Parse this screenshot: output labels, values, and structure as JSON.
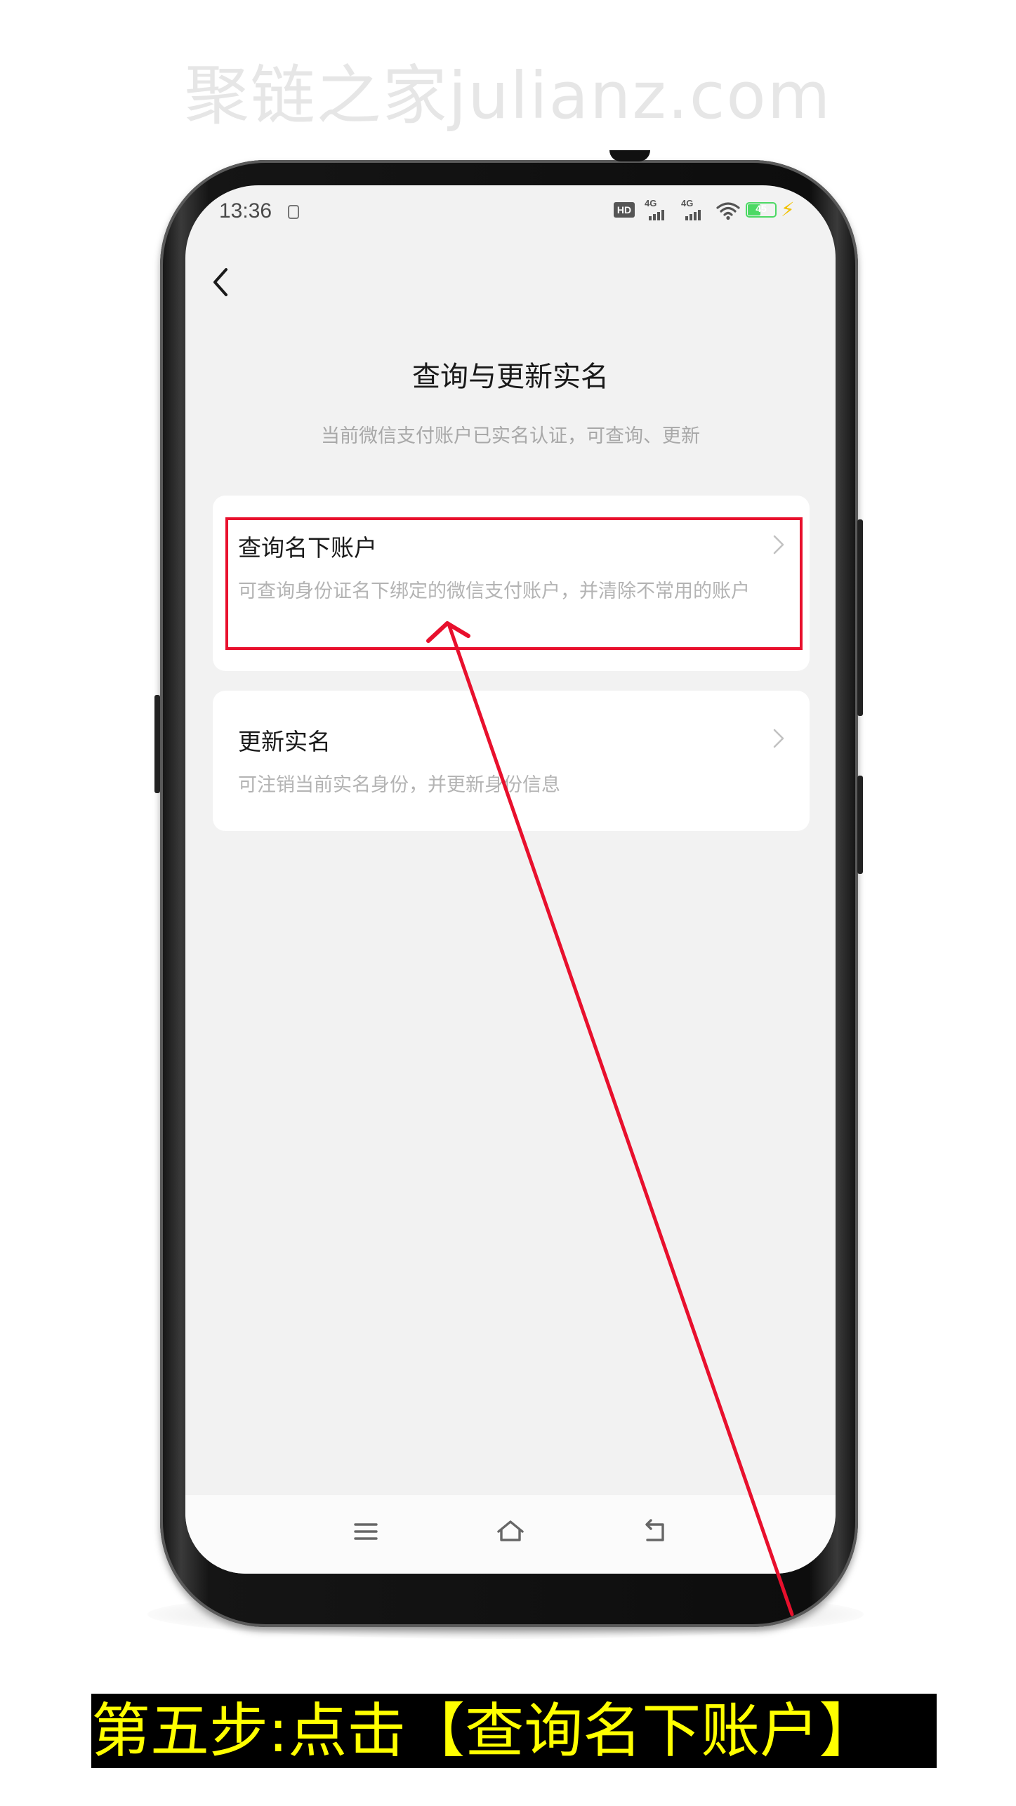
{
  "watermark": "聚链之家julianz.com",
  "status_bar": {
    "time": "13:36",
    "hd_label": "HD",
    "net1_label": "4G",
    "net2_label": "4G",
    "battery_level": "45",
    "icons": [
      "notification-icon",
      "hd-icon",
      "signal-icon",
      "signal-icon",
      "wifi-icon",
      "battery-icon",
      "charging-icon"
    ]
  },
  "header": {
    "back_icon": "chevron-left-icon",
    "title": "查询与更新实名",
    "subtitle": "当前微信支付账户已实名认证，可查询、更新"
  },
  "options": [
    {
      "title": "查询名下账户",
      "description": "可查询身份证名下绑定的微信支付账户，并清除不常用的账户",
      "icon": "chevron-right-icon"
    },
    {
      "title": "更新实名",
      "description": "可注销当前实名身份，并更新身份信息",
      "icon": "chevron-right-icon"
    }
  ],
  "nav_bar": {
    "icons": [
      "menu-icon",
      "home-icon",
      "back-icon"
    ]
  },
  "annotation": {
    "caption": "第五步:点击【查询名下账户】",
    "highlight_color": "#e8102d",
    "caption_text_color": "#ffff00"
  }
}
